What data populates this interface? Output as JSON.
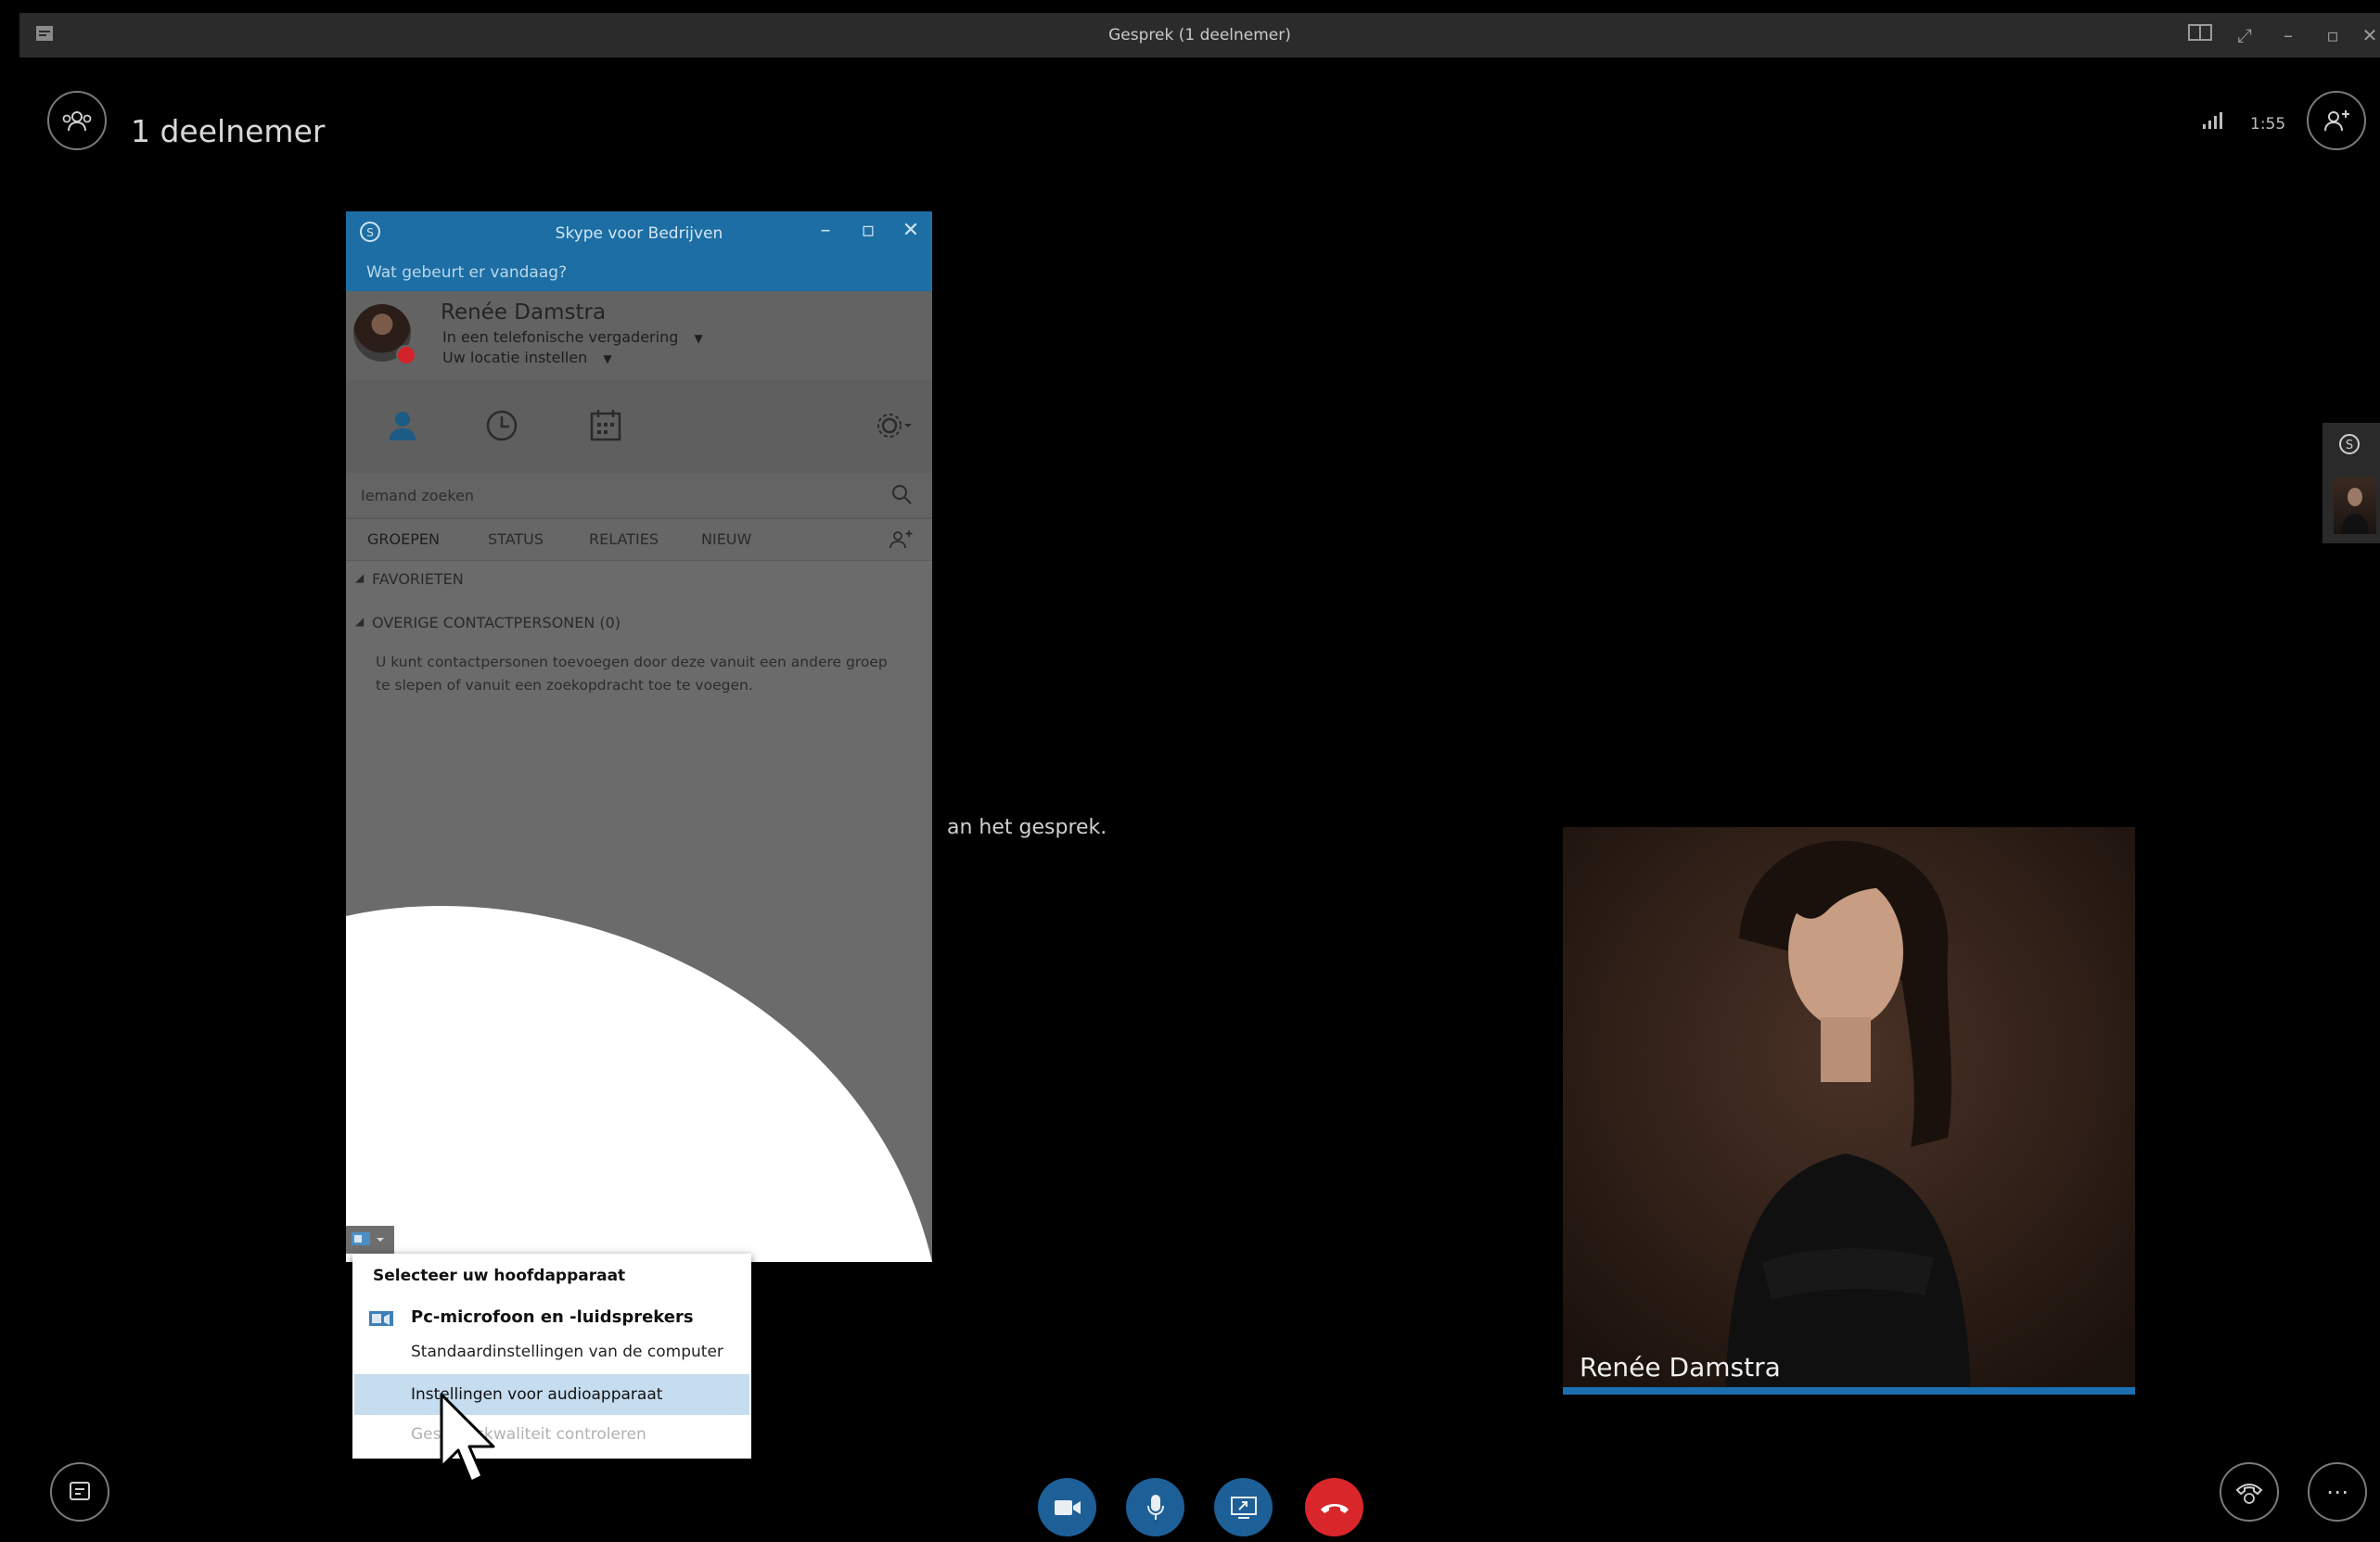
{
  "window": {
    "title": "Gesprek (1 deelnemer)"
  },
  "header": {
    "participants_label": "1 deelnemer",
    "time": "1:55"
  },
  "skype": {
    "title": "Skype voor Bedrijven",
    "mood_prompt": "Wat gebeurt er vandaag?",
    "user_name": "Renée Damstra",
    "status": "In een telefonische vergadering",
    "location": "Uw locatie instellen",
    "search_placeholder": "Iemand zoeken",
    "filter_tabs": [
      "GROEPEN",
      "STATUS",
      "RELATIES",
      "NIEUW"
    ],
    "groups": [
      "FAVORIETEN",
      "OVERIGE CONTACTPERSONEN (0)"
    ],
    "hint_line1": "U kunt contactpersonen toevoegen door deze vanuit een andere groep",
    "hint_line2": "te slepen of vanuit een zoekopdracht toe te voegen."
  },
  "device_menu": {
    "header": "Selecteer uw hoofdapparaat",
    "device_name": "Pc-microfoon en -luidsprekers",
    "device_sub": "Standaardinstellingen van de computer",
    "audio_settings": "Instellingen voor audioapparaat",
    "check_quality": "Gesprekskwaliteit controleren"
  },
  "stage": {
    "partial_text": "an het gesprek."
  },
  "video": {
    "participant_name": "Renée Damstra"
  },
  "colors": {
    "skype_blue": "#1c6ea4",
    "hangup_red": "#d9262b",
    "call_blue": "#1d5f97",
    "presence_busy": "#d3222a"
  }
}
